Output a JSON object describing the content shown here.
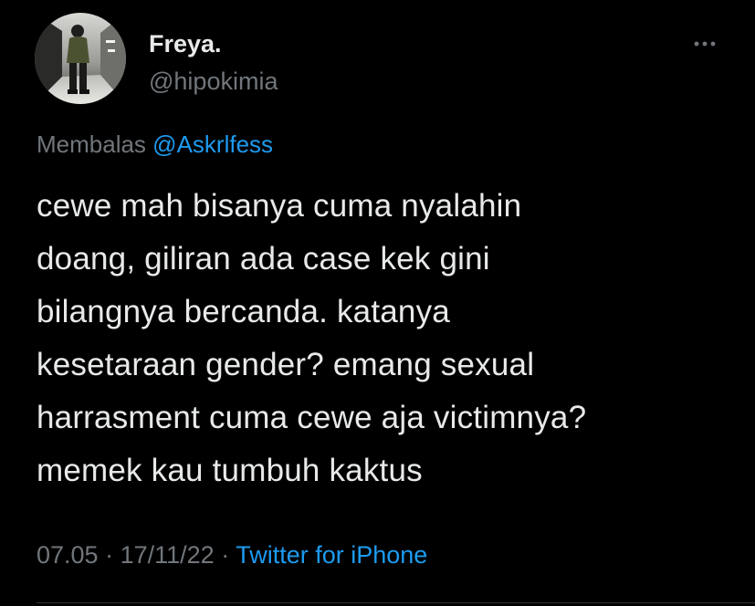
{
  "author": {
    "display_name": "Freya.",
    "handle": "@hipokimia"
  },
  "reply": {
    "prefix": "Membalas",
    "mention": "@Askrlfess"
  },
  "tweet": {
    "text": "cewe mah bisanya cuma nyalahin\ndoang, giliran ada case kek gini\nbilangnya bercanda. katanya\nkesetaraan gender? emang sexual\nharrasment cuma cewe aja victimnya?\nmemek kau tumbuh kaktus"
  },
  "meta": {
    "time": "07.05",
    "separator1": " · ",
    "date": "17/11/22",
    "separator2": " · ",
    "source": "Twitter for iPhone"
  },
  "icons": {
    "more": "more-horizontal-icon",
    "avatar": "profile-photo"
  },
  "colors": {
    "background": "#000000",
    "primary_text": "#e7e9ea",
    "secondary_text": "#71767b",
    "link": "#1d9bf0"
  }
}
